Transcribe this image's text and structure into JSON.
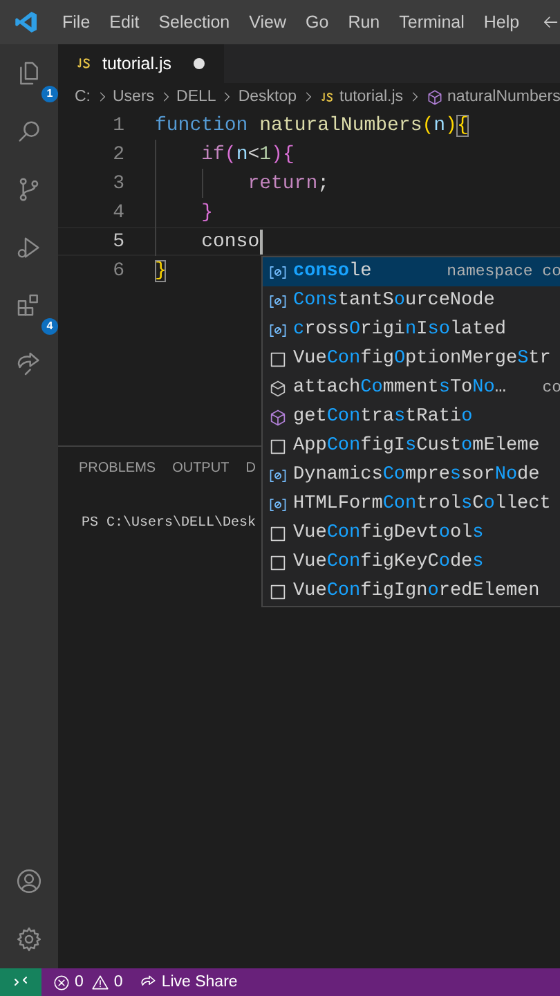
{
  "menu": [
    "File",
    "Edit",
    "Selection",
    "View",
    "Go",
    "Run",
    "Terminal",
    "Help"
  ],
  "activity_bar": {
    "top": [
      {
        "kind": "files",
        "badge": "1"
      },
      {
        "kind": "search"
      },
      {
        "kind": "source-control"
      },
      {
        "kind": "run"
      },
      {
        "kind": "extensions",
        "badge": "4"
      },
      {
        "kind": "live-share"
      }
    ],
    "bottom": [
      {
        "kind": "account"
      },
      {
        "kind": "settings"
      }
    ]
  },
  "tabs": [
    {
      "label": "tutorial.js",
      "selected": true,
      "modified": true
    }
  ],
  "breadcrumb": [
    {
      "label": "C:"
    },
    {
      "label": "Users"
    },
    {
      "label": "DELL"
    },
    {
      "label": "Desktop"
    },
    {
      "label": "tutorial.js",
      "kind": "js"
    },
    {
      "label": "naturalNumbers",
      "kind": "function"
    }
  ],
  "editor": {
    "lines": [
      {
        "number": "1",
        "tokens": [
          {
            "text": "function",
            "kind": "keyword"
          },
          {
            "text": "naturalNumbers",
            "kind": "function",
            "space_before": true
          },
          {
            "text": "(",
            "kind": "bracket1"
          },
          {
            "text": "n",
            "kind": "param"
          },
          {
            "text": ")",
            "kind": "bracket1"
          },
          {
            "text": "{",
            "kind": "bracket1",
            "matched": true
          }
        ],
        "children": [
          {
            "number": "2",
            "tokens": [
              {
                "text": "if",
                "kind": "control"
              },
              {
                "text": "(",
                "kind": "bracket2"
              },
              {
                "text": "n",
                "kind": "param"
              },
              {
                "text": "<",
                "kind": "plain"
              },
              {
                "text": "1",
                "kind": "number"
              },
              {
                "text": ")",
                "kind": "bracket2"
              },
              {
                "text": "{",
                "kind": "bracket2"
              }
            ],
            "children": [
              {
                "number": "3",
                "tokens": [
                  {
                    "text": "return",
                    "kind": "control"
                  },
                  {
                    "text": ";",
                    "kind": "plain"
                  }
                ]
              }
            ]
          },
          {
            "number": "4",
            "tokens": [
              {
                "text": "}",
                "kind": "bracket2"
              }
            ]
          },
          {
            "number": "5",
            "current": true,
            "cursor": true,
            "tokens": [
              {
                "text": "conso",
                "kind": "plain"
              }
            ]
          }
        ]
      },
      {
        "number": "6",
        "tokens": [
          {
            "text": "}",
            "kind": "bracket1",
            "matched": true
          }
        ]
      }
    ]
  },
  "suggestions": [
    {
      "kind": "variable",
      "selected": true,
      "parts": [
        {
          "text": "conso",
          "match": true
        },
        {
          "text": "le",
          "match": false
        }
      ],
      "detail": "namespace co"
    },
    {
      "kind": "variable",
      "selected": false,
      "parts": [
        {
          "text": "Cons",
          "match": true
        },
        {
          "text": "tantS",
          "match": false
        },
        {
          "text": "o",
          "match": true
        },
        {
          "text": "urceNode",
          "match": false
        }
      ]
    },
    {
      "kind": "variable",
      "selected": false,
      "parts": [
        {
          "text": "c",
          "match": true
        },
        {
          "text": "ross",
          "match": false
        },
        {
          "text": "O",
          "match": true
        },
        {
          "text": "rigi",
          "match": false
        },
        {
          "text": "n",
          "match": true
        },
        {
          "text": "I",
          "match": false
        },
        {
          "text": "so",
          "match": true
        },
        {
          "text": "lated",
          "match": false
        }
      ]
    },
    {
      "kind": "interface",
      "selected": false,
      "parts": [
        {
          "text": "Vue",
          "match": false
        },
        {
          "text": "Con",
          "match": true
        },
        {
          "text": "fig",
          "match": false
        },
        {
          "text": "O",
          "match": true
        },
        {
          "text": "ptionMerge",
          "match": false
        },
        {
          "text": "S",
          "match": true
        },
        {
          "text": "tr",
          "match": false
        }
      ]
    },
    {
      "kind": "method",
      "selected": false,
      "parts": [
        {
          "text": "attach",
          "match": false
        },
        {
          "text": "Co",
          "match": true
        },
        {
          "text": "mment",
          "match": false
        },
        {
          "text": "s",
          "match": true
        },
        {
          "text": "To",
          "match": false
        },
        {
          "text": "No",
          "match": true
        },
        {
          "text": "…",
          "match": false
        }
      ],
      "detail": "co"
    },
    {
      "kind": "function",
      "selected": false,
      "parts": [
        {
          "text": "get",
          "match": false
        },
        {
          "text": "Con",
          "match": true
        },
        {
          "text": "tra",
          "match": false
        },
        {
          "text": "s",
          "match": true
        },
        {
          "text": "tRati",
          "match": false
        },
        {
          "text": "o",
          "match": true
        }
      ]
    },
    {
      "kind": "interface",
      "selected": false,
      "parts": [
        {
          "text": "App",
          "match": false
        },
        {
          "text": "Con",
          "match": true
        },
        {
          "text": "figI",
          "match": false
        },
        {
          "text": "s",
          "match": true
        },
        {
          "text": "Cust",
          "match": false
        },
        {
          "text": "o",
          "match": true
        },
        {
          "text": "mEleme",
          "match": false
        }
      ]
    },
    {
      "kind": "variable",
      "selected": false,
      "parts": [
        {
          "text": "Dynamics",
          "match": false
        },
        {
          "text": "Co",
          "match": true
        },
        {
          "text": "mpre",
          "match": false
        },
        {
          "text": "s",
          "match": true
        },
        {
          "text": "sor",
          "match": false
        },
        {
          "text": "No",
          "match": true
        },
        {
          "text": "de",
          "match": false
        }
      ]
    },
    {
      "kind": "variable",
      "selected": false,
      "parts": [
        {
          "text": "HTMLForm",
          "match": false
        },
        {
          "text": "Con",
          "match": true
        },
        {
          "text": "trol",
          "match": false
        },
        {
          "text": "s",
          "match": true
        },
        {
          "text": "C",
          "match": false
        },
        {
          "text": "o",
          "match": true
        },
        {
          "text": "llect",
          "match": false
        }
      ]
    },
    {
      "kind": "interface",
      "selected": false,
      "parts": [
        {
          "text": "Vue",
          "match": false
        },
        {
          "text": "Con",
          "match": true
        },
        {
          "text": "figDevt",
          "match": false
        },
        {
          "text": "o",
          "match": true
        },
        {
          "text": "ol",
          "match": false
        },
        {
          "text": "s",
          "match": true
        }
      ]
    },
    {
      "kind": "interface",
      "selected": false,
      "parts": [
        {
          "text": "Vue",
          "match": false
        },
        {
          "text": "Con",
          "match": true
        },
        {
          "text": "figKeyC",
          "match": false
        },
        {
          "text": "o",
          "match": true
        },
        {
          "text": "de",
          "match": false
        },
        {
          "text": "s",
          "match": true
        }
      ]
    },
    {
      "kind": "interface",
      "selected": false,
      "parts": [
        {
          "text": "Vue",
          "match": false
        },
        {
          "text": "Con",
          "match": true
        },
        {
          "text": "figIgn",
          "match": false
        },
        {
          "text": "o",
          "match": true
        },
        {
          "text": "redElemen",
          "match": false
        }
      ]
    }
  ],
  "panel": {
    "tabs": [
      {
        "label": "PROBLEMS",
        "selected": false
      },
      {
        "label": "OUTPUT",
        "selected": false
      },
      {
        "label": "D",
        "selected": false
      }
    ],
    "terminal": "PS C:\\Users\\DELL\\Desk"
  },
  "status_bar": {
    "errors": "0",
    "warnings": "0",
    "live_share": "Live Share"
  }
}
